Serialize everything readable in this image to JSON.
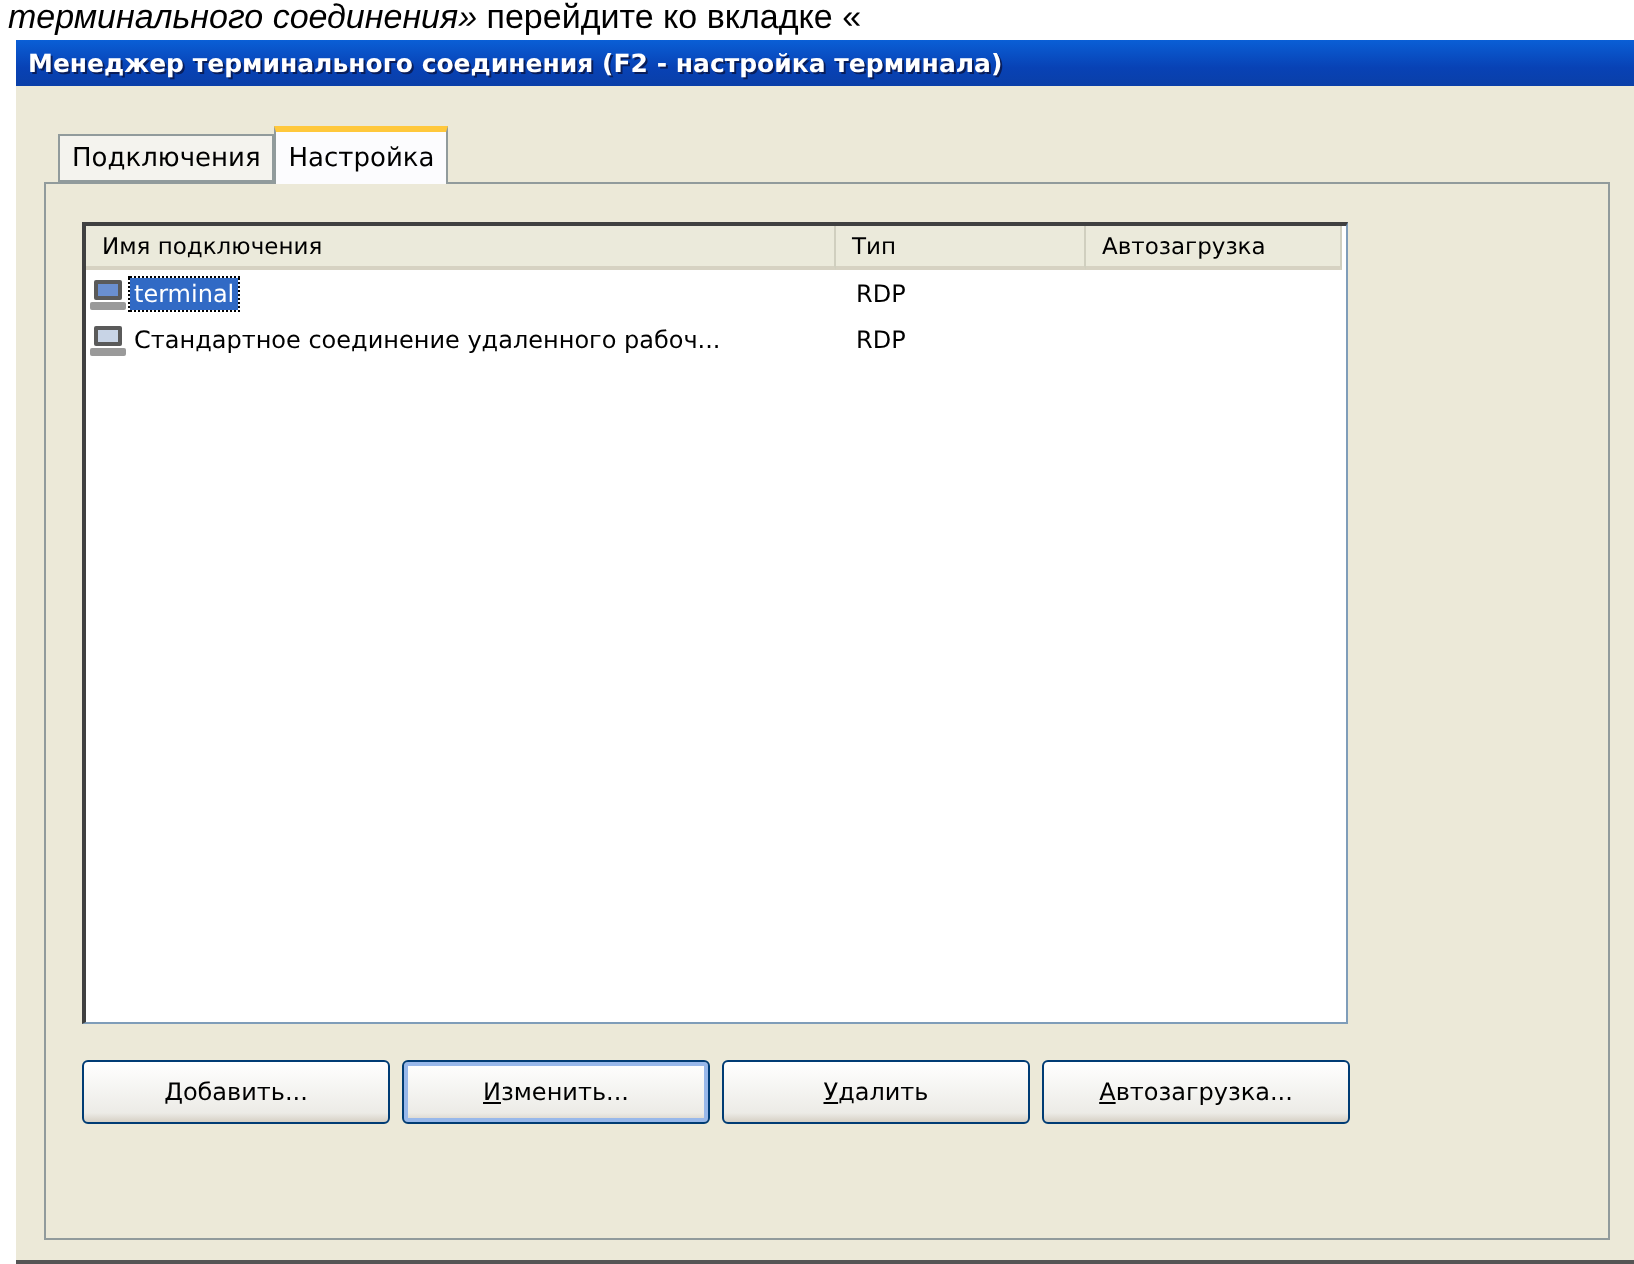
{
  "document_line": "*терминального соединения»* перейдите ко вкладке «",
  "window": {
    "title": "Менеджер терминального соединения (F2 - настройка терминала)"
  },
  "tabs": [
    {
      "label": "Подключения",
      "selected": false
    },
    {
      "label": "Настройка",
      "selected": true
    }
  ],
  "table": {
    "columns": [
      "Имя подключения",
      "Тип",
      "Автозагрузка"
    ],
    "rows": [
      {
        "name": "terminal",
        "type": "RDP",
        "selected": true
      },
      {
        "name": "Стандартное соединение удаленного рабоч...",
        "type": "RDP",
        "selected": false
      }
    ]
  },
  "buttons": [
    {
      "label": "Добавить...",
      "focused": false
    },
    {
      "label": "Изменить...",
      "focused": true
    },
    {
      "label": "Удалить",
      "focused": false
    },
    {
      "label": "Автозагрузка...",
      "focused": false
    }
  ]
}
